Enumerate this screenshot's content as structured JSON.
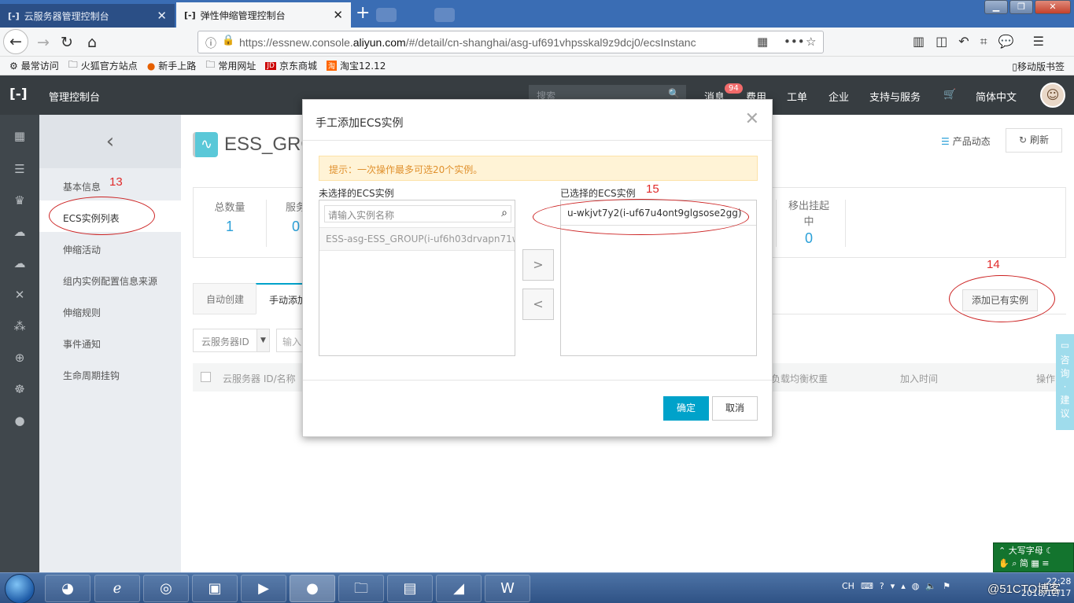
{
  "browser": {
    "tabs": [
      {
        "label": "云服务器管理控制台",
        "active": false
      },
      {
        "label": "弹性伸缩管理控制台",
        "active": true
      }
    ],
    "url_prefix": "https://essnew.console.",
    "url_domain": "aliyun.com",
    "url_suffix": "/#/detail/cn-shanghai/asg-uf691vhpsskal9z9dcj0/ecsInstanc",
    "bookmarks": [
      "最常访问",
      "火狐官方站点",
      "新手上路",
      "常用网址",
      "京东商城",
      "淘宝12.12"
    ],
    "mobile_bookmarks": "移动版书签"
  },
  "topbar": {
    "title": "管理控制台",
    "search_placeholder": "搜索",
    "menu": [
      "消息",
      "费用",
      "工单",
      "企业",
      "支持与服务",
      "简体中文"
    ],
    "message_badge": "94"
  },
  "sidenav": {
    "items": [
      "基本信息",
      "ECS实例列表",
      "伸缩活动",
      "组内实例配置信息来源",
      "伸缩规则",
      "事件通知",
      "生命周期挂钩"
    ],
    "active_index": 1
  },
  "page": {
    "name": "ESS_GROUP",
    "name_visible": "ESS_GRO",
    "news_label": "产品动态",
    "refresh_label": "刷新",
    "stats": [
      {
        "label": "总数量",
        "value": "1"
      },
      {
        "label": "服务",
        "value": "0"
      },
      {
        "label": "移出挂起中",
        "value": "0"
      }
    ],
    "tabs": [
      "自动创建",
      "手动添加"
    ],
    "add_button": "添加已有实例",
    "filter_select": "云服务器ID",
    "filter_input_placeholder": "输入",
    "table_headers": [
      "云服务器 ID/名称",
      "负载均衡权重",
      "加入时间",
      "操作"
    ]
  },
  "modal": {
    "title": "手工添加ECS实例",
    "tip": "提示：一次操作最多可选20个实例。",
    "left_label": "未选择的ECS实例",
    "right_label": "已选择的ECS实例",
    "search_placeholder": "请输入实例名称",
    "unselected_items": [
      "ESS-asg-ESS_GROUP(i-uf6h03drvapn71w..."
    ],
    "selected_items": [
      "u-wkjvt7y2(i-uf67u4ont9glgsose2gg)"
    ],
    "move_right": ">",
    "move_left": "<",
    "ok_label": "确定",
    "cancel_label": "取消"
  },
  "annotations": [
    "13",
    "14",
    "15"
  ],
  "feedback_label": "咨询·建议",
  "taskbar": {
    "ime": [
      "大写字母",
      "简"
    ],
    "lang": "CH",
    "time": "22:28",
    "date": "2018/12/17",
    "watermark": "@51CTO博客"
  }
}
